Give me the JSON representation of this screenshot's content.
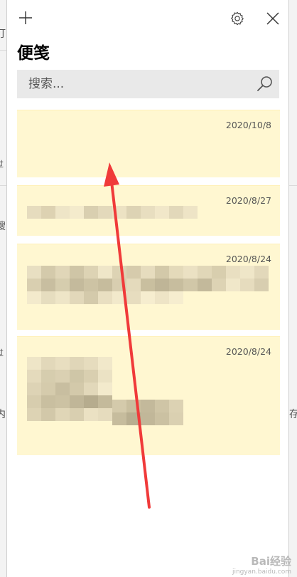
{
  "window": {
    "title": "便笺",
    "add_icon": "plus-icon",
    "settings_icon": "gear-icon",
    "close_icon": "close-icon"
  },
  "search": {
    "placeholder": "搜索...",
    "icon": "search-icon"
  },
  "notes": [
    {
      "date": "2020/10/8",
      "content": ""
    },
    {
      "date": "2020/8/27",
      "content": "(pixelated)"
    },
    {
      "date": "2020/8/24",
      "content": "(pixelated)"
    },
    {
      "date": "2020/8/24",
      "content": "(pixelated)"
    }
  ],
  "background_fragments": [
    "打",
    "过",
    "搜",
    "过",
    "内",
    "存"
  ],
  "watermark": {
    "text": "Bai经验",
    "sub": "jingyan.baidu.com"
  },
  "colors": {
    "note_bg": "#fff7d1",
    "arrow": "#f03a3a",
    "search_bg": "#e9e9e9"
  }
}
